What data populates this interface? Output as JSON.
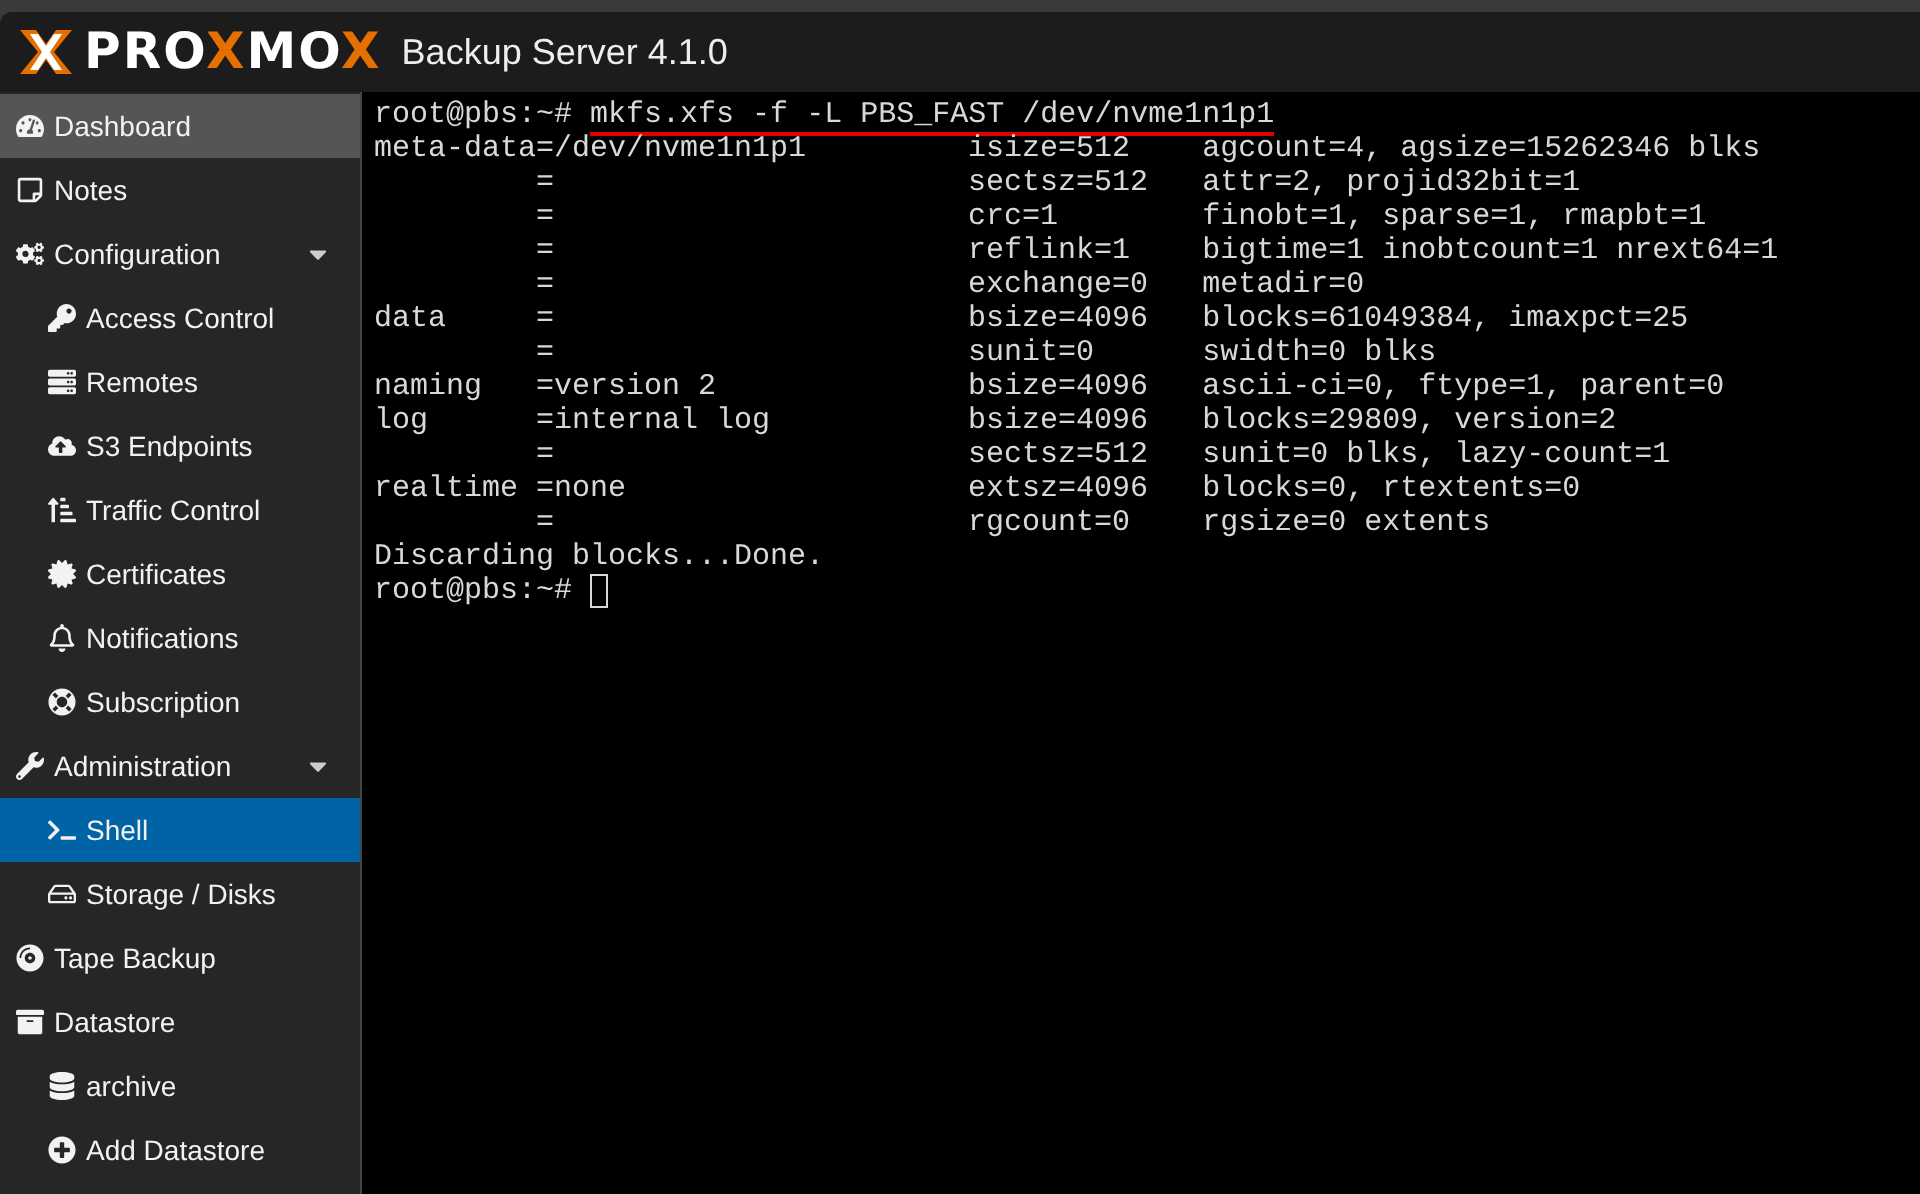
{
  "header": {
    "logo": "PROXMOX",
    "product": "Backup Server 4.1.0"
  },
  "sidebar": {
    "items": [
      {
        "label": "Dashboard",
        "selected": false,
        "hovered": true
      },
      {
        "label": "Notes",
        "selected": false,
        "hovered": false
      },
      {
        "label": "Configuration",
        "selected": false,
        "hovered": false,
        "expanded": true,
        "children": [
          {
            "label": "Access Control",
            "selected": false,
            "hovered": false
          },
          {
            "label": "Remotes",
            "selected": false,
            "hovered": false
          },
          {
            "label": "S3 Endpoints",
            "selected": false,
            "hovered": false
          },
          {
            "label": "Traffic Control",
            "selected": false,
            "hovered": false
          },
          {
            "label": "Certificates",
            "selected": false,
            "hovered": false
          },
          {
            "label": "Notifications",
            "selected": false,
            "hovered": false
          },
          {
            "label": "Subscription",
            "selected": false,
            "hovered": false
          }
        ]
      },
      {
        "label": "Administration",
        "selected": false,
        "hovered": false,
        "expanded": true,
        "children": [
          {
            "label": "Shell",
            "selected": true,
            "hovered": false
          },
          {
            "label": "Storage / Disks",
            "selected": false,
            "hovered": false
          }
        ]
      },
      {
        "label": "Tape Backup",
        "selected": false,
        "hovered": false
      },
      {
        "label": "Datastore",
        "selected": false,
        "hovered": false,
        "children": [
          {
            "label": "archive",
            "selected": false,
            "hovered": false
          },
          {
            "label": "Add Datastore",
            "selected": false,
            "hovered": false
          }
        ]
      }
    ]
  },
  "terminal": {
    "prompt": "root@pbs:~#",
    "command": "mkfs.xfs -f -L PBS_FAST /dev/nvme1n1p1",
    "command_underlined": true,
    "lines": [
      "meta-data=/dev/nvme1n1p1         isize=512    agcount=4, agsize=15262346 blks",
      "         =                       sectsz=512   attr=2, projid32bit=1",
      "         =                       crc=1        finobt=1, sparse=1, rmapbt=1",
      "         =                       reflink=1    bigtime=1 inobtcount=1 nrext64=1",
      "         =                       exchange=0   metadir=0",
      "data     =                       bsize=4096   blocks=61049384, imaxpct=25",
      "         =                       sunit=0      swidth=0 blks",
      "naming   =version 2              bsize=4096   ascii-ci=0, ftype=1, parent=0",
      "log      =internal log           bsize=4096   blocks=29809, version=2",
      "         =                       sectsz=512   sunit=0 blks, lazy-count=1",
      "realtime =none                   extsz=4096   blocks=0, rtextents=0",
      "         =                       rgcount=0    rgsize=0 extents",
      "Discarding blocks...Done."
    ],
    "final_prompt": "root@pbs:~#"
  }
}
